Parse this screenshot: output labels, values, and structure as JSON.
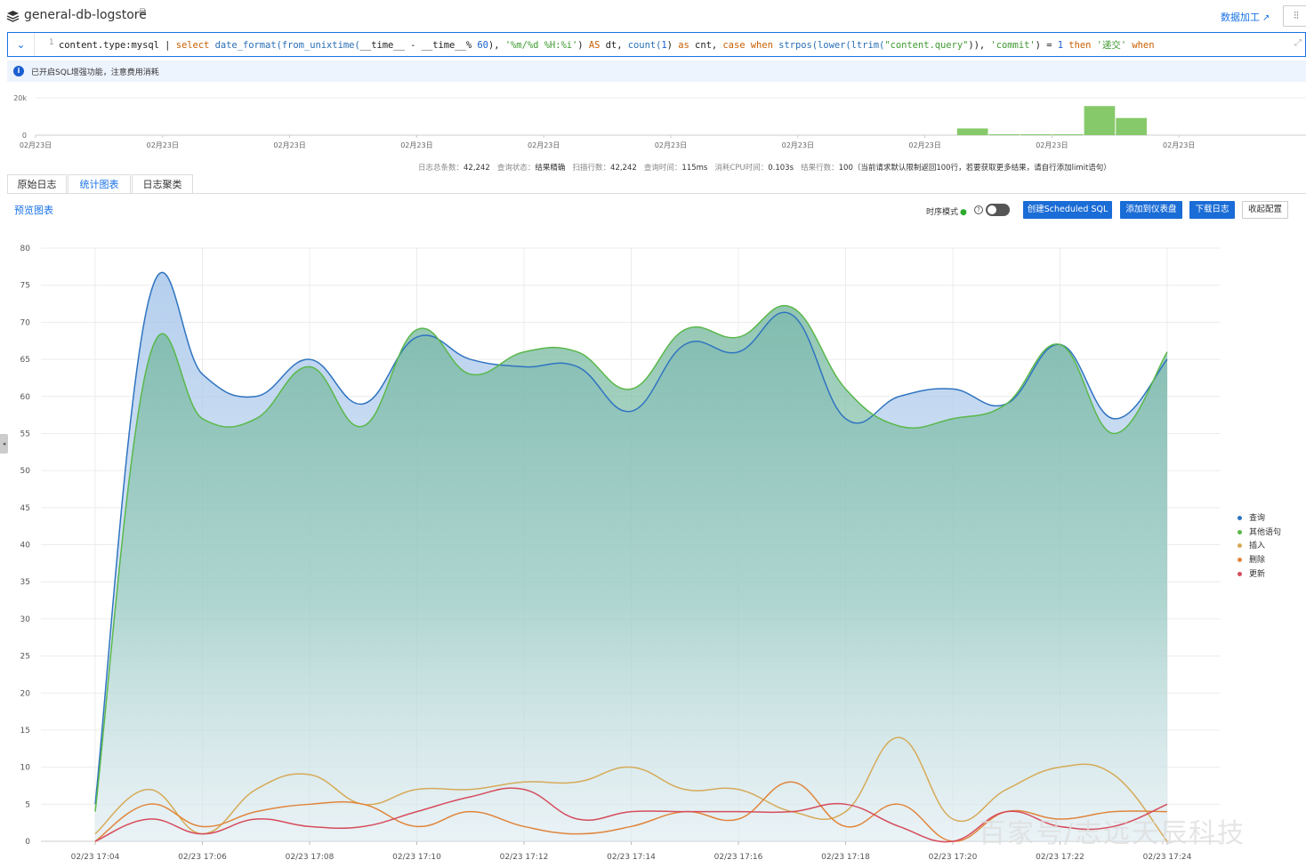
{
  "header": {
    "logstore": "general-db-logstore",
    "data_process": "数据加工",
    "tune_icon": "sliders-icon"
  },
  "query": {
    "line_number": "1",
    "segments": [
      {
        "t": "content.type:mysql | ",
        "c": "op"
      },
      {
        "t": "select ",
        "c": "kw"
      },
      {
        "t": "date_format(from_unixtime(",
        "c": "fn"
      },
      {
        "t": "__time__ - __time__% ",
        "c": "op"
      },
      {
        "t": "60",
        "c": "num"
      },
      {
        "t": "), ",
        "c": "op"
      },
      {
        "t": "'%m/%d %H:%i'",
        "c": "str"
      },
      {
        "t": ") ",
        "c": "op"
      },
      {
        "t": "AS ",
        "c": "kw"
      },
      {
        "t": "dt, ",
        "c": "op"
      },
      {
        "t": "count(",
        "c": "fn"
      },
      {
        "t": "1",
        "c": "num"
      },
      {
        "t": ") ",
        "c": "op"
      },
      {
        "t": "as ",
        "c": "kw"
      },
      {
        "t": "cnt, ",
        "c": "op"
      },
      {
        "t": "case when ",
        "c": "kw"
      },
      {
        "t": "strpos(lower(ltrim(",
        "c": "fn"
      },
      {
        "t": "\"content.query\"",
        "c": "str"
      },
      {
        "t": ")), ",
        "c": "op"
      },
      {
        "t": "'commit'",
        "c": "str"
      },
      {
        "t": ") = ",
        "c": "op"
      },
      {
        "t": "1 ",
        "c": "num"
      },
      {
        "t": "then ",
        "c": "kw"
      },
      {
        "t": "'递交' ",
        "c": "str"
      },
      {
        "t": "when",
        "c": "kw"
      }
    ]
  },
  "notice": "已开启SQL增强功能，注意费用消耗",
  "histogram": {
    "y_label": "20k",
    "y_zero": "0",
    "x_labels": [
      "02月23日",
      "02月23日",
      "02月23日",
      "02月23日",
      "02月23日",
      "02月23日",
      "02月23日",
      "02月23日",
      "02月23日",
      "02月23日"
    ],
    "bars": [
      {
        "index": 29,
        "value": 0.18
      },
      {
        "index": 30,
        "value": 0.02
      },
      {
        "index": 31,
        "value": 0.02
      },
      {
        "index": 32,
        "value": 0.02
      },
      {
        "index": 33,
        "value": 0.78
      },
      {
        "index": 34,
        "value": 0.46
      }
    ],
    "color": "#86c96a"
  },
  "stats": {
    "total_label": "日志总条数：",
    "total": "42,242",
    "status_label": "查询状态：",
    "status": "结果精确",
    "scan_label": "扫描行数：",
    "scan": "42,242",
    "time_label": "查询时间：",
    "time": "115ms",
    "cpu_label": "消耗CPU时间：",
    "cpu": "0.103s",
    "rows_label": "结果行数：",
    "rows": "100（当前请求默认限制返回100行，若要获取更多结果，请自行添加limit语句）"
  },
  "tabs": [
    "原始日志",
    "统计图表",
    "日志聚类"
  ],
  "active_tab": 1,
  "toolbar": {
    "preview": "预览图表",
    "ts_mode": "时序模式",
    "btn_scheduled": "创建Scheduled SQL",
    "btn_dashboard": "添加到仪表盘",
    "btn_download": "下载日志",
    "btn_collapse": "收起配置"
  },
  "watermark": "百家号/志远天辰科技",
  "chart_data": {
    "type": "area",
    "title": "",
    "xlabel": "",
    "ylabel": "",
    "ylim": [
      0,
      80
    ],
    "yticks": [
      0,
      5,
      10,
      15,
      20,
      25,
      30,
      35,
      40,
      45,
      50,
      55,
      60,
      65,
      70,
      75,
      80
    ],
    "x": [
      "02/23 17:04",
      "02/23 17:05",
      "02/23 17:06",
      "02/23 17:07",
      "02/23 17:08",
      "02/23 17:09",
      "02/23 17:10",
      "02/23 17:11",
      "02/23 17:12",
      "02/23 17:13",
      "02/23 17:14",
      "02/23 17:15",
      "02/23 17:16",
      "02/23 17:17",
      "02/23 17:18",
      "02/23 17:19",
      "02/23 17:20",
      "02/23 17:21",
      "02/23 17:22",
      "02/23 17:23",
      "02/23 17:24"
    ],
    "xticks": [
      "02/23 17:04",
      "02/23 17:06",
      "02/23 17:08",
      "02/23 17:10",
      "02/23 17:12",
      "02/23 17:14",
      "02/23 17:16",
      "02/23 17:18",
      "02/23 17:20",
      "02/23 17:22",
      "02/23 17:24"
    ],
    "grid": true,
    "legend_position": "right",
    "series": [
      {
        "name": "查询",
        "color": "#2f74c0",
        "fill": true,
        "values": [
          5,
          73,
          63,
          60,
          65,
          59,
          68,
          65,
          64,
          64,
          58,
          67,
          66,
          71,
          57,
          60,
          61,
          59,
          67,
          57,
          65
        ]
      },
      {
        "name": "其他语句",
        "color": "#5ab84a",
        "fill": true,
        "values": [
          4,
          65,
          57,
          57,
          64,
          56,
          69,
          63,
          66,
          66,
          61,
          69,
          68,
          72,
          61,
          56,
          57,
          59,
          67,
          55,
          66
        ]
      },
      {
        "name": "插入",
        "color": "#d6aa58",
        "fill": false,
        "values": [
          1,
          7,
          1,
          7,
          9,
          5,
          7,
          7,
          8,
          8,
          10,
          7,
          7,
          4,
          4,
          14,
          3,
          7,
          10,
          9,
          0
        ]
      },
      {
        "name": "删除",
        "color": "#e0853c",
        "fill": false,
        "values": [
          0,
          5,
          2,
          4,
          5,
          5,
          2,
          4,
          2,
          1,
          2,
          4,
          3,
          8,
          2,
          5,
          0,
          4,
          3,
          4,
          4
        ]
      },
      {
        "name": "更新",
        "color": "#d64c5c",
        "fill": false,
        "values": [
          0,
          3,
          1,
          3,
          2,
          2,
          4,
          6,
          7,
          3,
          4,
          4,
          4,
          4,
          5,
          2,
          0,
          4,
          2,
          2,
          5
        ]
      }
    ]
  }
}
